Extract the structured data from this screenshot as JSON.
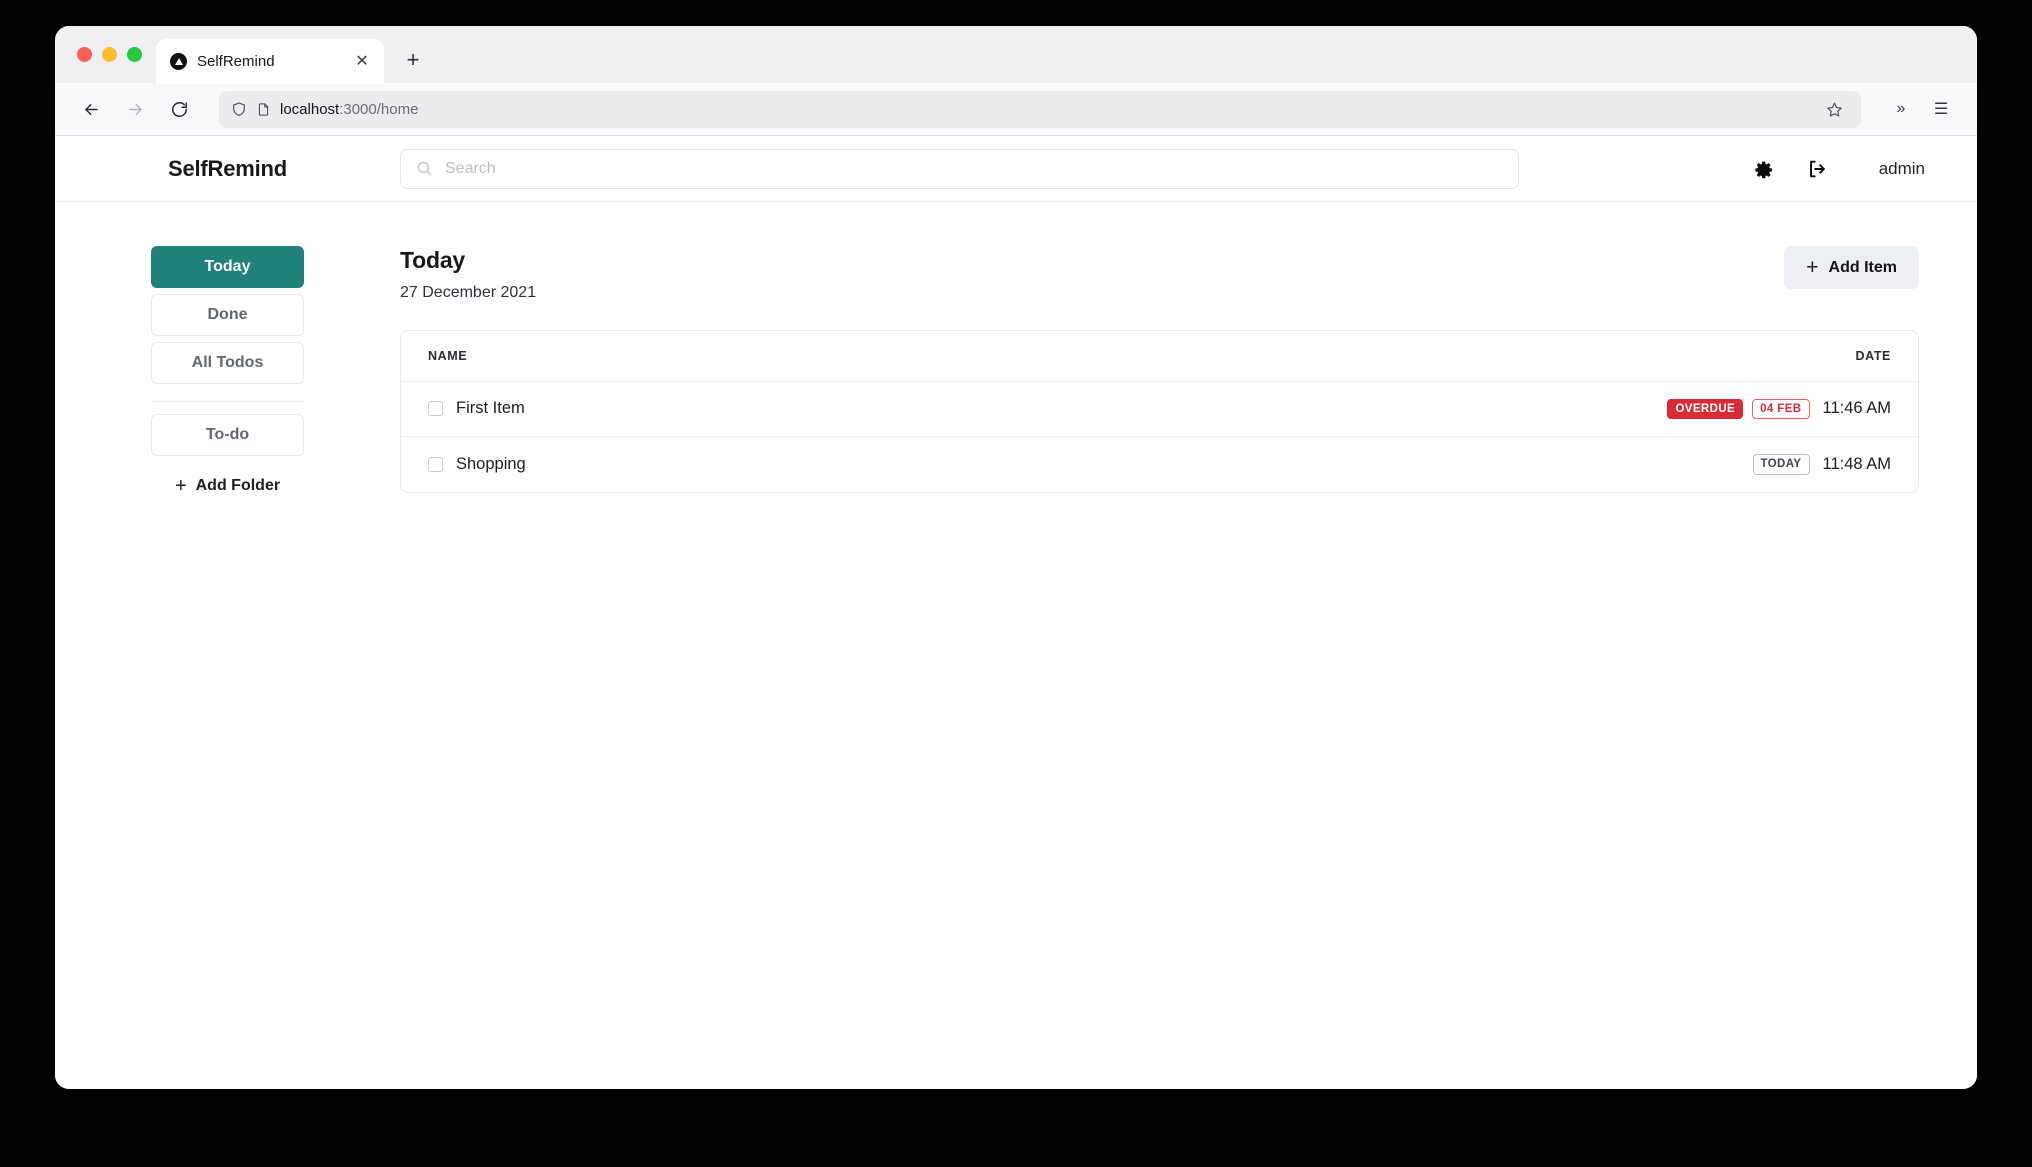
{
  "browser": {
    "tab": {
      "title": "SelfRemind",
      "favicon": "triangle-in-circle-icon",
      "close_label": "✕"
    },
    "new_tab_label": "+",
    "nav": {
      "back": "back-arrow-icon",
      "forward": "forward-arrow-icon",
      "reload": "reload-icon"
    },
    "url": {
      "host": "localhost",
      "rest": ":3000/home",
      "shield_icon": "shield-icon",
      "page_icon": "page-icon",
      "star_icon": "star-icon"
    },
    "toolbar": {
      "overflow_label": "»",
      "menu_label": "☰"
    }
  },
  "app": {
    "brand": "SelfRemind",
    "search": {
      "placeholder": "Search",
      "value": ""
    },
    "header_actions": {
      "settings_icon": "gear-icon",
      "logout_icon": "logout-icon",
      "user": "admin"
    }
  },
  "sidebar": {
    "views": [
      {
        "label": "Today",
        "active": true
      },
      {
        "label": "Done",
        "active": false
      },
      {
        "label": "All Todos",
        "active": false
      }
    ],
    "folders": [
      {
        "label": "To-do",
        "active": false
      }
    ],
    "add_folder": {
      "icon": "plus-icon",
      "label": "Add Folder"
    }
  },
  "main": {
    "title": "Today",
    "date": "27 December 2021",
    "add_item": {
      "icon": "plus-icon",
      "label": "Add Item"
    },
    "table": {
      "columns": [
        "NAME",
        "DATE"
      ],
      "rows": [
        {
          "checked": false,
          "name": "First Item",
          "badges": [
            {
              "text": "OVERDUE",
              "style": "overdue"
            },
            {
              "text": "04 FEB",
              "style": "date-red"
            }
          ],
          "time": "11:46 AM"
        },
        {
          "checked": false,
          "name": "Shopping",
          "badges": [
            {
              "text": "TODAY",
              "style": "today"
            }
          ],
          "time": "11:48 AM"
        }
      ]
    }
  },
  "colors": {
    "accent_teal": "#20807a",
    "danger_red": "#d92a35",
    "button_gray": "#eceff4",
    "border_gray": "#e6e8eb"
  }
}
